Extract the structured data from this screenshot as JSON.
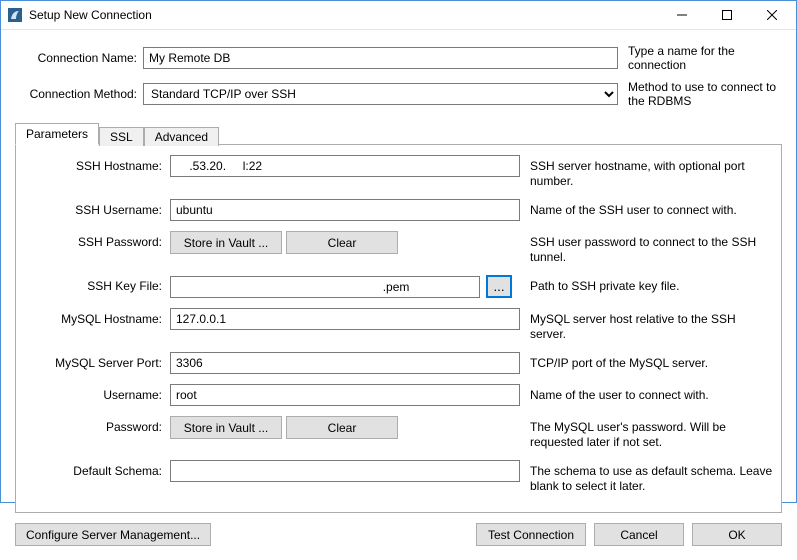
{
  "window": {
    "title": "Setup New Connection"
  },
  "top": {
    "name_label": "Connection Name:",
    "name_value": "My Remote DB",
    "name_help": "Type a name for the connection",
    "method_label": "Connection Method:",
    "method_value": "Standard TCP/IP over SSH",
    "method_help": "Method to use to connect to the RDBMS"
  },
  "tabs": {
    "parameters": "Parameters",
    "ssl": "SSL",
    "advanced": "Advanced"
  },
  "fields": {
    "ssh_hostname": {
      "label": "SSH Hostname:",
      "value": "    .53.20.     l:22",
      "help": "SSH server hostname, with  optional port number."
    },
    "ssh_username": {
      "label": "SSH Username:",
      "value": "ubuntu",
      "help": "Name of the SSH user to connect with."
    },
    "ssh_password": {
      "label": "SSH Password:",
      "vault": "Store in Vault ...",
      "clear": "Clear",
      "help": "SSH user password to connect to the SSH tunnel."
    },
    "ssh_keyfile": {
      "label": "SSH Key File:",
      "value": "                                                              .pem",
      "browse": "...",
      "help": "Path to SSH private key file."
    },
    "mysql_hostname": {
      "label": "MySQL Hostname:",
      "value": "127.0.0.1",
      "help": "MySQL server host relative to the SSH server."
    },
    "mysql_port": {
      "label": "MySQL Server Port:",
      "value": "3306",
      "help": "TCP/IP port of the MySQL server."
    },
    "username": {
      "label": "Username:",
      "value": "root",
      "help": "Name of the user to connect with."
    },
    "password": {
      "label": "Password:",
      "vault": "Store in Vault ...",
      "clear": "Clear",
      "help": "The MySQL user's password. Will be requested later if not set."
    },
    "default_schema": {
      "label": "Default Schema:",
      "value": "",
      "help": "The schema to use as default schema. Leave blank to select it later."
    }
  },
  "footer": {
    "configure": "Configure Server Management...",
    "test": "Test Connection",
    "cancel": "Cancel",
    "ok": "OK"
  }
}
